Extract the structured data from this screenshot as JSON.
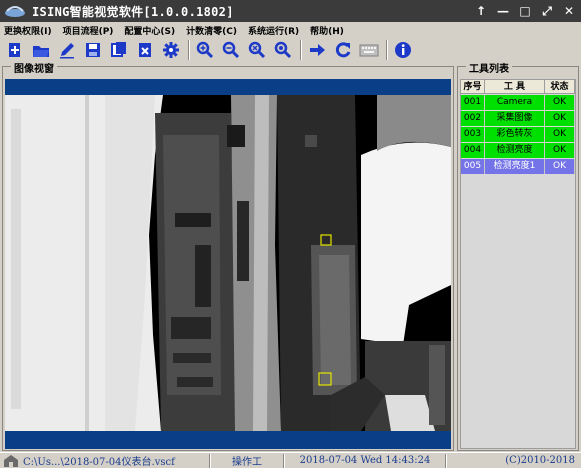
{
  "window": {
    "title": "ISING智能视觉软件[1.0.0.1802]",
    "controls": [
      "↑",
      "—",
      "□",
      "⤢",
      "✕"
    ]
  },
  "menu": [
    {
      "label": "更换权限(I)"
    },
    {
      "label": "项目流程(P)"
    },
    {
      "label": "配置中心(S)"
    },
    {
      "label": "计数清零(C)"
    },
    {
      "label": "系统运行(R)"
    },
    {
      "label": "帮助(H)"
    }
  ],
  "toolbar": {
    "icons": [
      "new-icon",
      "open-folder-icon",
      "edit-icon",
      "save-icon",
      "copy-icon",
      "delete-icon",
      "settings-gear-icon",
      "zoom-in-icon",
      "zoom-out-icon",
      "zoom-fit-icon",
      "zoom-reset-icon",
      "run-arrow-icon",
      "refresh-loop-icon",
      "keyboard-icon",
      "info-icon"
    ],
    "accent": "#1c39c7"
  },
  "image_panel": {
    "label": "图像视窗",
    "frame_color": "#0a3e87"
  },
  "tool_panel": {
    "label": "工具列表",
    "headers": [
      "序号",
      "工 具",
      "状态"
    ],
    "rows": [
      {
        "id": "001",
        "name": "Camera",
        "status": "OK",
        "state": "ok"
      },
      {
        "id": "002",
        "name": "采集图像",
        "status": "OK",
        "state": "ok"
      },
      {
        "id": "003",
        "name": "彩色转灰",
        "status": "OK",
        "state": "ok"
      },
      {
        "id": "004",
        "name": "检测亮度",
        "status": "OK",
        "state": "ok"
      },
      {
        "id": "005",
        "name": "检测亮度1",
        "status": "OK",
        "state": "sel"
      }
    ],
    "ok_color": "#00e000",
    "selected_color": "#7474e8"
  },
  "status": {
    "file": "C:\\Us...\\2018-07-04仪表台.vscf",
    "user": "操作工",
    "time": "2018-07-04 Wed 14:43:24",
    "copyright": "(C)2010-2018"
  }
}
